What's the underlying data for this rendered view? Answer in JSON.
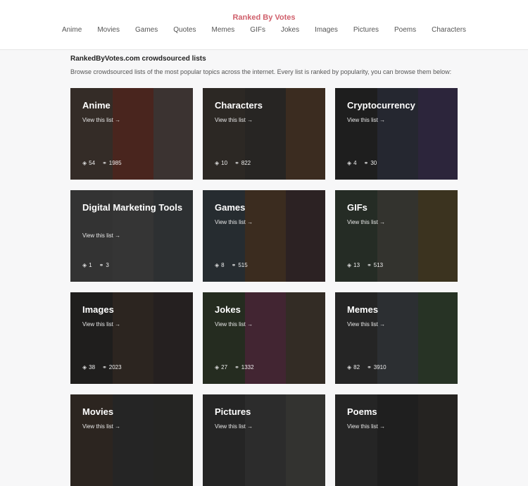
{
  "header": {
    "brand": "Ranked By Votes",
    "nav": [
      "Anime",
      "Movies",
      "Games",
      "Quotes",
      "Memes",
      "GIFs",
      "Jokes",
      "Images",
      "Pictures",
      "Poems",
      "Characters"
    ]
  },
  "intro": {
    "title": "RankedByVotes.com crowdsourced lists",
    "description": "Browse crowdsourced lists of the most popular topics across the internet. Every list is ranked by popularity, you can browse them below:"
  },
  "view_label": "View this list →",
  "cards": [
    {
      "title": "Anime",
      "lists": "54",
      "links": "1985",
      "colors": [
        "#5b4a3e",
        "#8a3a2a",
        "#6a5a55"
      ]
    },
    {
      "title": "Characters",
      "lists": "10",
      "links": "822",
      "colors": [
        "#4a4038",
        "#3e3a36",
        "#6b4a30"
      ]
    },
    {
      "title": "Cryptocurrency",
      "lists": "4",
      "links": "30",
      "colors": [
        "#2a2a2c",
        "#3a3f52",
        "#4a3a6a"
      ]
    },
    {
      "title": "Digital Marketing Tools",
      "lists": "1",
      "links": "3",
      "colors": [
        "#595959",
        "#5e5e5e",
        "#4d5358"
      ]
    },
    {
      "title": "Games",
      "lists": "8",
      "links": "515",
      "colors": [
        "#3d4a52",
        "#6a4a2e",
        "#4a3436"
      ]
    },
    {
      "title": "GIFs",
      "lists": "13",
      "links": "513",
      "colors": [
        "#3a4a3a",
        "#5a5a4e",
        "#6a5a2e"
      ]
    },
    {
      "title": "Images",
      "lists": "38",
      "links": "2023",
      "colors": [
        "#2e2a28",
        "#4a3a30",
        "#3a3030"
      ]
    },
    {
      "title": "Jokes",
      "lists": "27",
      "links": "1332",
      "colors": [
        "#3a4a30",
        "#7a3a58",
        "#5a4a3a"
      ]
    },
    {
      "title": "Memes",
      "lists": "82",
      "links": "3910",
      "colors": [
        "#3a3a3a",
        "#4a5058",
        "#3e5a3a"
      ]
    },
    {
      "title": "Movies",
      "lists": "",
      "links": "",
      "colors": [
        "#4a3a30",
        "#3a3a3a",
        "#3a3a36"
      ]
    },
    {
      "title": "Pictures",
      "lists": "",
      "links": "",
      "colors": [
        "#3a3a3a",
        "#4a4a4a",
        "#5a5a52"
      ]
    },
    {
      "title": "Poems",
      "lists": "",
      "links": "",
      "colors": [
        "#3a3a3a",
        "#2e2e2e",
        "#3a3632"
      ]
    }
  ]
}
